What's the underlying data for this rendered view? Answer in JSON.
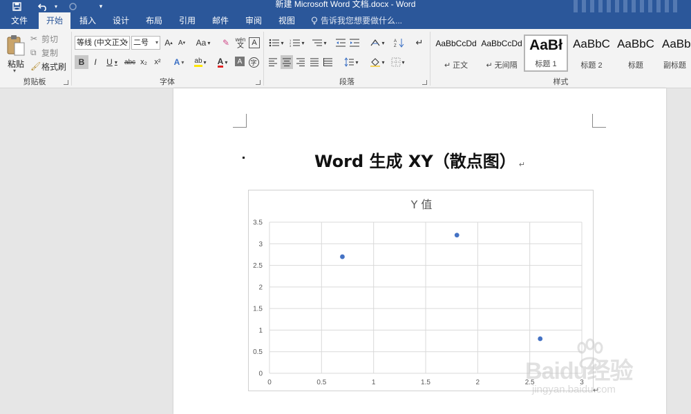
{
  "window": {
    "title": "新建 Microsoft Word 文档.docx - Word"
  },
  "quick_access": {
    "save_icon": "save-icon",
    "undo_icon": "undo-icon",
    "redo_icon": "redo-icon",
    "customize_icon": "customize-icon"
  },
  "tabs": [
    "文件",
    "开始",
    "插入",
    "设计",
    "布局",
    "引用",
    "邮件",
    "审阅",
    "视图"
  ],
  "active_tab": "开始",
  "tell_me": "告诉我您想要做什么...",
  "ribbon": {
    "clipboard": {
      "label": "剪贴板",
      "paste": "粘贴",
      "cut": "剪切",
      "copy": "复制",
      "format_painter": "格式刷"
    },
    "font": {
      "label": "字体",
      "font_name": "等线 (中文正文",
      "font_size": "二号",
      "change_case": "Aa",
      "bold": "B",
      "italic": "I",
      "underline": "U",
      "strikethrough": "abc",
      "subscript": "x₂",
      "superscript": "x²",
      "phonetic": "wén",
      "char_border": "A",
      "enclose": "字"
    },
    "paragraph": {
      "label": "段落"
    },
    "styles": {
      "label": "样式",
      "items": [
        {
          "preview": "AaBbCcDd",
          "name": "正文"
        },
        {
          "preview": "AaBbCcDd",
          "name": "无间隔"
        },
        {
          "preview": "AaBł",
          "name": "标题 1"
        },
        {
          "preview": "AaBbC",
          "name": "标题 2"
        },
        {
          "preview": "AaBbC",
          "name": "标题"
        },
        {
          "preview": "AaBb",
          "name": "副标题"
        }
      ]
    }
  },
  "document": {
    "heading": "Word 生成 XY（散点图）",
    "para_mark": "↵"
  },
  "chart_data": {
    "type": "scatter",
    "title": "Y 值",
    "xlabel": "",
    "ylabel": "",
    "xlim": [
      0,
      3
    ],
    "ylim": [
      0,
      3.5
    ],
    "x_ticks": [
      "0",
      "0.5",
      "1",
      "1.5",
      "2",
      "2.5",
      "3"
    ],
    "y_ticks": [
      "0",
      "0.5",
      "1",
      "1.5",
      "2",
      "2.5",
      "3",
      "3.5"
    ],
    "grid": true,
    "legend": "none",
    "series": [
      {
        "x": [
          0.7,
          1.8,
          2.6
        ],
        "y": [
          2.7,
          3.2,
          0.8
        ]
      }
    ],
    "marker_color": "#4472c4"
  },
  "watermark": {
    "text": "Baidu经验",
    "url": "jingyan.baidu.com"
  },
  "colors": {
    "accent": "#2b579a"
  }
}
